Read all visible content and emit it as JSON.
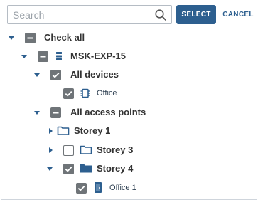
{
  "search": {
    "placeholder": "Search",
    "value": ""
  },
  "buttons": {
    "select": "SELECT",
    "cancel": "CANCEL"
  },
  "colors": {
    "accent": "#2d5f8f",
    "checkbox": "#6f7478",
    "icon_blue": "#2d5f8f"
  },
  "tree": {
    "check_all": "Check all",
    "server": "MSK-EXP-15",
    "all_devices": "All devices",
    "office_device": "Office",
    "all_access_points": "All access points",
    "storey_1": "Storey 1",
    "storey_3": "Storey 3",
    "storey_4": "Storey 4",
    "office_1": "Office 1"
  },
  "icons": {
    "search": "search-icon",
    "server": "server-icon",
    "device": "chip-icon",
    "folder": "folder-icon",
    "door": "door-icon"
  }
}
